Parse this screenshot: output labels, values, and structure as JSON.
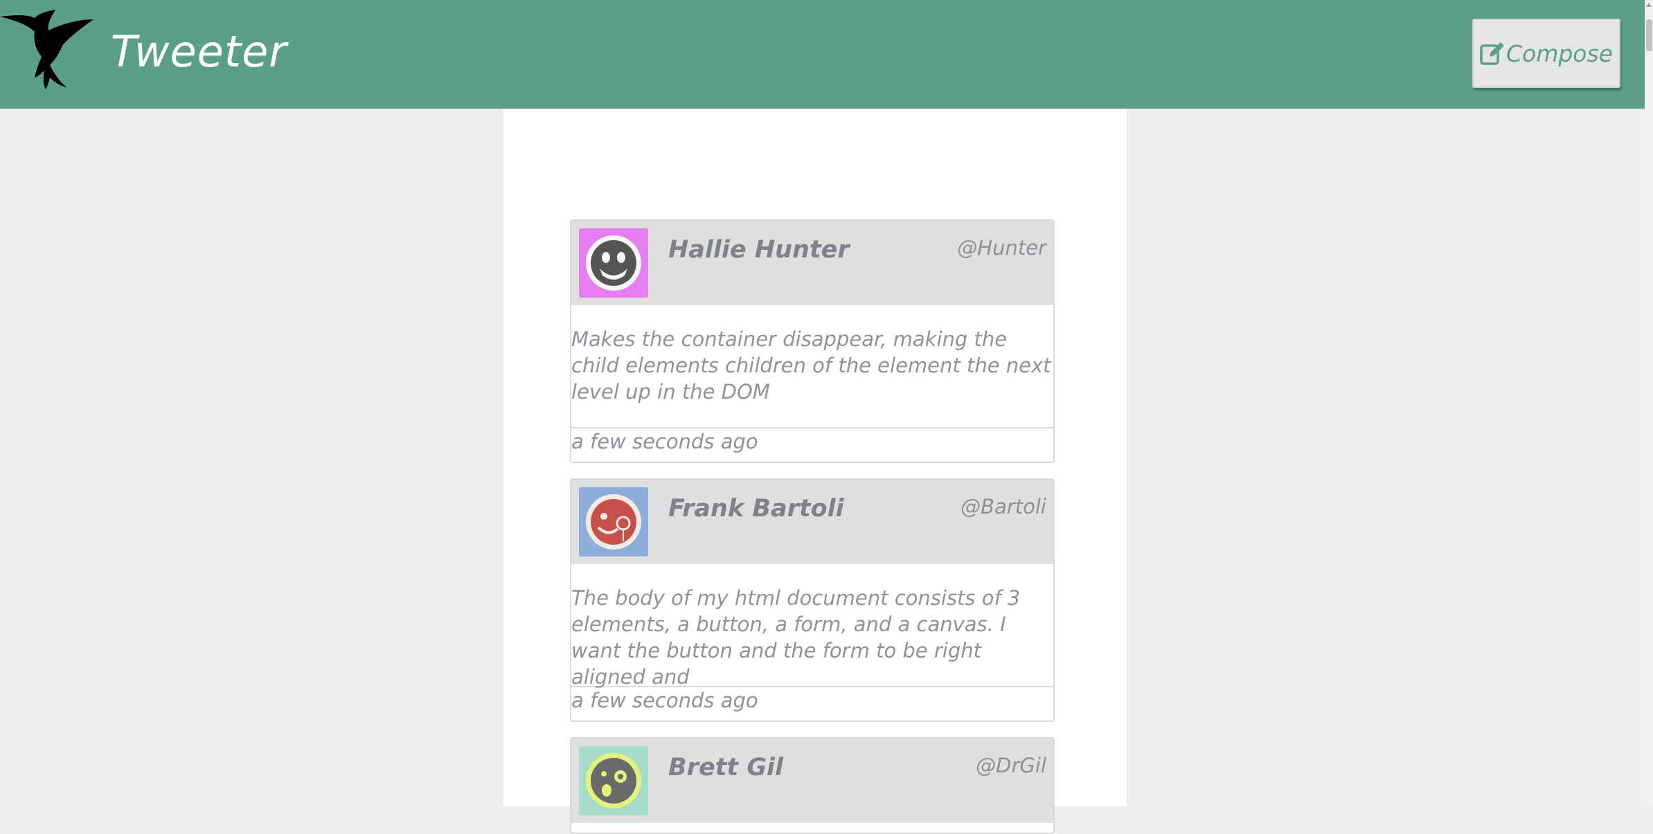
{
  "header": {
    "brand": "Tweeter",
    "compose_label": "Compose",
    "bar_color": "#5c9f87",
    "logo_icon": "hummingbird-icon"
  },
  "tweets": [
    {
      "name": "Hallie Hunter",
      "handle": "@Hunter",
      "text": "Makes the container disappear, making the child elements children of the element the next level up in the DOM",
      "time": "a few seconds ago",
      "avatar_bg": "#e57ff0",
      "avatar_icon": "grinning-face-avatar-icon"
    },
    {
      "name": "Frank Bartoli",
      "handle": "@Bartoli",
      "text": "The body of my html document consists of 3 elements, a button, a form, and a canvas. I want the button and the form to be right aligned and",
      "time": "a few seconds ago",
      "avatar_bg": "#8fadda",
      "avatar_icon": "monocle-face-avatar-icon"
    },
    {
      "name": "Brett Gil",
      "handle": "@DrGil",
      "text": "",
      "time": "",
      "avatar_bg": "#a8dcc8",
      "avatar_icon": "surprised-face-avatar-icon"
    }
  ]
}
